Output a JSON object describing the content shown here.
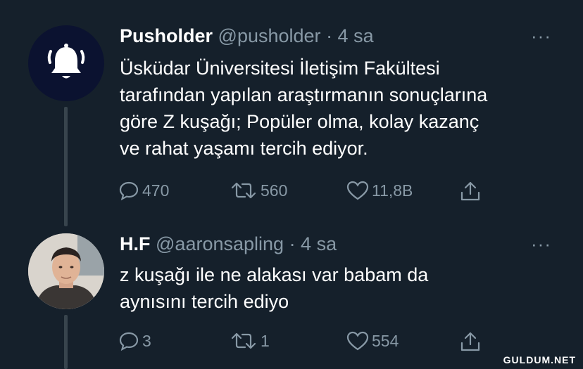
{
  "tweets": [
    {
      "display_name": "Pusholder",
      "handle": "@pusholder",
      "time": "· 4 sa",
      "more": "···",
      "lines": [
        "Üsküdar Üniversitesi İletişim Fakültesi",
        "tarafından yapılan araştırmanın sonuçlarına",
        "göre Z kuşağı; Popüler olma, kolay kazanç",
        "ve rahat yaşamı tercih ediyor."
      ],
      "replies": "470",
      "retweets": "560",
      "likes": "11,8B",
      "avatar_icon": "bell-icon"
    },
    {
      "display_name": "H.F",
      "handle": "@aaronsapling",
      "time": "· 4 sa",
      "more": "···",
      "lines": [
        "z kuşağı ile ne alakası var babam da",
        "aynısını tercih ediyo"
      ],
      "replies": "3",
      "retweets": "1",
      "likes": "554"
    }
  ],
  "watermark": "GULDUM.NET",
  "colors": {
    "background": "#15202b",
    "muted": "#8899a6",
    "text": "#ffffff",
    "thread": "#38444d"
  }
}
